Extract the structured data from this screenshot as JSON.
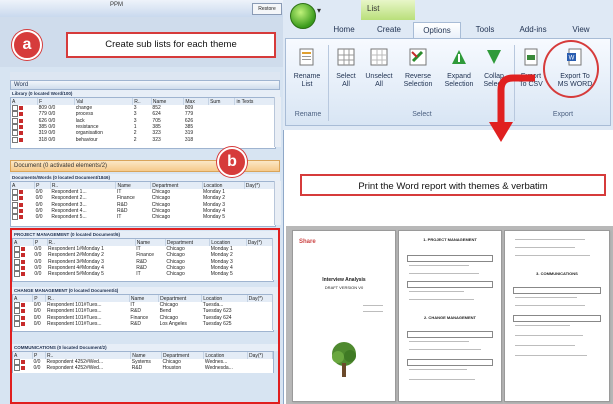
{
  "left": {
    "title": "PPM",
    "restore_label": "Restore",
    "badge": "a",
    "callout": "Create sub lists for each theme",
    "word_panel": {
      "header": "Word",
      "subheader": "Library (0 located Word/100)",
      "columns": [
        "A",
        "F",
        "Val",
        "R..",
        "Name",
        "Max",
        "Sum",
        "in Texts"
      ],
      "rows": [
        [
          "809 0/0",
          "change",
          "3",
          "852",
          "809"
        ],
        [
          "779 0/0",
          "process",
          "3",
          "624",
          "779"
        ],
        [
          "626 0/0",
          "lack",
          "3",
          "705",
          "626"
        ],
        [
          "385 0/0",
          "resistance",
          "1",
          "385",
          "385"
        ],
        [
          "319 0/0",
          "organisation",
          "2",
          "323",
          "319"
        ],
        [
          "318 0/0",
          "behaviour",
          "2",
          "323",
          "318"
        ]
      ]
    },
    "document_bar": "Document (0 activated elements/2)",
    "docs_panel": {
      "subheader": "Documents/Words (0 located Document/1846)",
      "columns": [
        "A",
        "P",
        "R..",
        "Name",
        "Department",
        "Location",
        "Day(*)"
      ],
      "rows": [
        [
          "0/0",
          "Respondent 1...",
          "IT",
          "Chicago",
          "Monday 1"
        ],
        [
          "0/0",
          "Respondent 2...",
          "Finance",
          "Chicago",
          "Monday 2"
        ],
        [
          "0/0",
          "Respondent 3...",
          "R&D",
          "Chicago",
          "Monday 3"
        ],
        [
          "0/0",
          "Respondent 4...",
          "R&D",
          "Chicago",
          "Monday 4"
        ],
        [
          "0/0",
          "Respondent 5...",
          "IT",
          "Chicago",
          "Monday 5"
        ]
      ]
    },
    "project_panel": {
      "subheader": "PROJECT MANAGEMENT (0 located Document/6)",
      "columns": [
        "A",
        "P",
        "R..",
        "Name",
        "Department",
        "Location",
        "Day(*)"
      ],
      "rows": [
        [
          "0/0",
          "Respondent 1#Monday 1",
          "IT",
          "Chicago",
          "Monday 1"
        ],
        [
          "0/0",
          "Respondent 2#Monday 2",
          "Finance",
          "Chicago",
          "Monday 2"
        ],
        [
          "0/0",
          "Respondent 3#Monday 3",
          "R&D",
          "Chicago",
          "Monday 3"
        ],
        [
          "0/0",
          "Respondent 4#Monday 4",
          "R&D",
          "Chicago",
          "Monday 4"
        ],
        [
          "0/0",
          "Respondent 5#Monday 5",
          "IT",
          "Chicago",
          "Monday 5"
        ]
      ]
    },
    "change_panel": {
      "subheader": "CHANGE MANAGEMENT (0 located Document/4)",
      "columns": [
        "A",
        "P",
        "R..",
        "Name",
        "Department",
        "Location",
        "Day(*)"
      ],
      "rows": [
        [
          "0/0",
          "Respondent 101#Tues...",
          "IT",
          "Chicago",
          "Tuesda..."
        ],
        [
          "0/0",
          "Respondent 101#Tues...",
          "R&D",
          "Bend",
          "Tuesday 623"
        ],
        [
          "0/0",
          "Respondent 101#Tues...",
          "Finance",
          "Chicago",
          "Tuesday 624"
        ],
        [
          "0/0",
          "Respondent 101#Tues...",
          "R&D",
          "Los Angeles",
          "Tuesday 625"
        ]
      ]
    },
    "comm_panel": {
      "subheader": "COMMUNICATIONS (0 located Document/2)",
      "columns": [
        "A",
        "P",
        "R..",
        "Name",
        "Department",
        "Location",
        "Day(*)"
      ],
      "rows": [
        [
          "0/0",
          "Respondent 4252#Wed...",
          "Systems",
          "Chicago",
          "Wednes..."
        ],
        [
          "0/0",
          "Respondent 4252#Wed...",
          "R&D",
          "Houston",
          "Wednesda..."
        ]
      ]
    }
  },
  "ribbon": {
    "context_tab": "List",
    "tabs": [
      "Home",
      "Create",
      "Options",
      "Tools",
      "Add-ins",
      "View"
    ],
    "active_tab": "Options",
    "buttons": [
      {
        "label1": "Rename",
        "label2": "List"
      },
      {
        "label1": "Select",
        "label2": "All"
      },
      {
        "label1": "Unselect",
        "label2": "All"
      },
      {
        "label1": "Reverse",
        "label2": "Selection"
      },
      {
        "label1": "Expand",
        "label2": "Selection"
      },
      {
        "label1": "Collap",
        "label2": "Selecti"
      },
      {
        "label1": "Export",
        "label2": "To CSV"
      },
      {
        "label1": "Export To",
        "label2": "MS WORD"
      }
    ],
    "groups": [
      "Rename",
      "Select",
      "Export"
    ],
    "badge": "b",
    "colors": {
      "accent": "#d63b3b",
      "ribbon_bg": "#dfe9f5"
    }
  },
  "print": {
    "callout": "Print the Word report with themes & verbatim",
    "cover": {
      "logo": "Share",
      "title": "Interview Analysis",
      "subtitle": "DRAFT VERSION V0"
    },
    "page2": {
      "h1": "1. PROJECT MANAGEMENT",
      "h2": "2. CHANGE MANAGEMENT"
    },
    "page3": {
      "h1": "3. COMMUNICATIONS"
    }
  }
}
